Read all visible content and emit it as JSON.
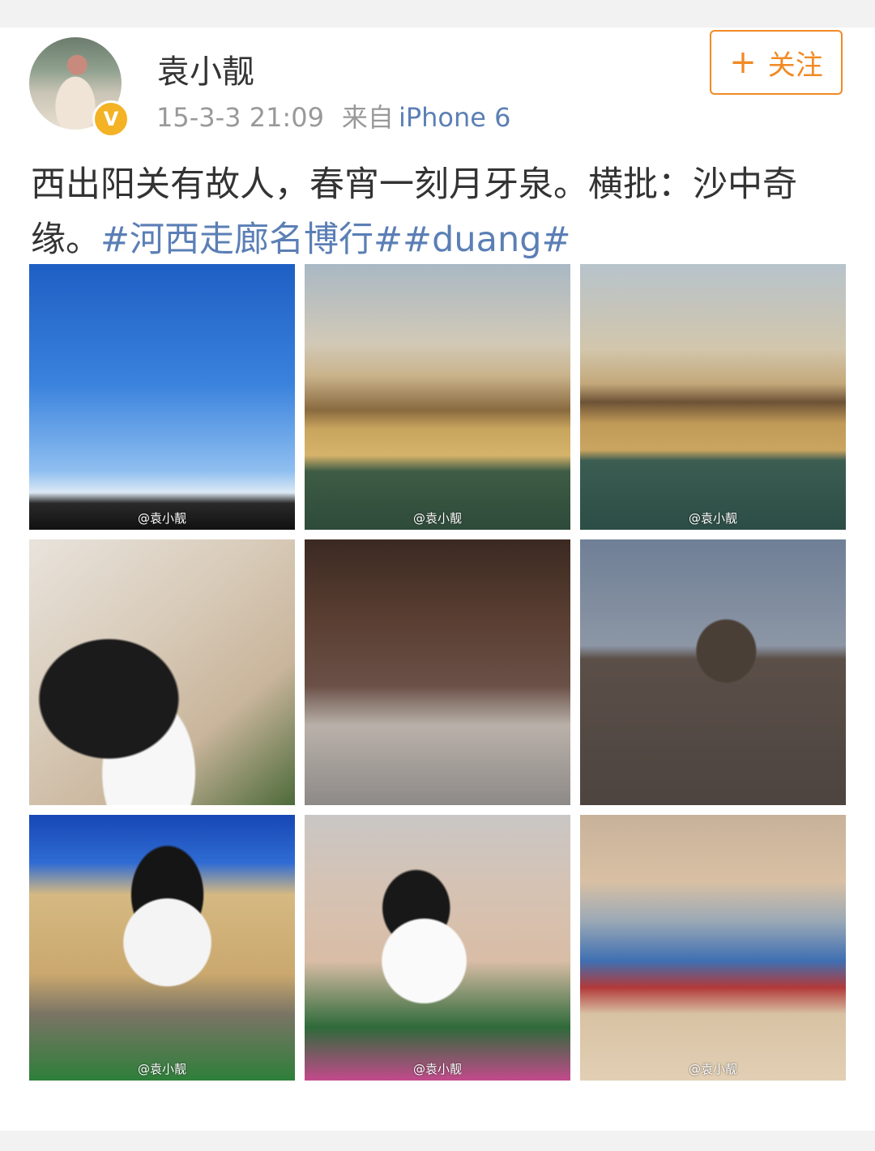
{
  "user": {
    "name": "袁小靓",
    "timestamp": "15-3-3 21:09",
    "source_prefix": "来自",
    "device": "iPhone 6",
    "verified_mark": "V"
  },
  "follow_button": {
    "plus": "+",
    "label": "关注"
  },
  "post": {
    "text": "西出阳关有故人，春宵一刻月牙泉。横批：沙中奇缘。",
    "hashtags": "#河西走廊名博行##duang#"
  },
  "photos": [
    {
      "watermark": "@袁小靓"
    },
    {
      "watermark": "@袁小靓"
    },
    {
      "watermark": "@袁小靓"
    },
    {
      "watermark": ""
    },
    {
      "watermark": ""
    },
    {
      "watermark": ""
    },
    {
      "watermark": "@袁小靓"
    },
    {
      "watermark": "@袁小靓"
    },
    {
      "watermark": "@袁小靓"
    }
  ],
  "colors": {
    "accent_orange": "#f18a25",
    "link_blue": "#5b7fb5",
    "verified_gold": "#f4b225"
  }
}
